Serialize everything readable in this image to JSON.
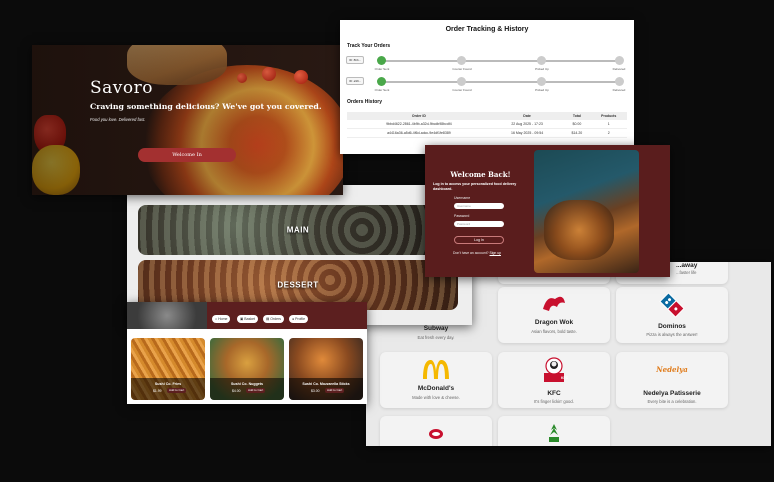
{
  "hero": {
    "brand": "Savoro",
    "tagline": "Craving something delicious? We've got you covered.",
    "subtext": "Food you love. Delivered fast.",
    "cta": "Welcome In"
  },
  "orders": {
    "title": "Order Tracking & History",
    "track_heading": "Track Your Orders",
    "history_heading": "Orders History",
    "trackers": [
      {
        "id": "ID: 8bb...",
        "steps": [
          "Order Sent",
          "Courier Found",
          "Picked Up",
          "Delivered"
        ],
        "active": 1
      },
      {
        "id": "ID: a99...",
        "steps": [
          "Order Sent",
          "Courier Found",
          "Picked Up",
          "Delivered"
        ],
        "active": 1
      }
    ],
    "columns": [
      "Order ID",
      "Date",
      "Total",
      "Products"
    ],
    "rows": [
      {
        "id": "9bbd4622-2861-4b9b-a32d-9bcdb98bcdf4",
        "date": "22 Aug 2025 - 17:23",
        "total": "$0.00",
        "products": "1"
      },
      {
        "id": "a4416a36-a5d6-4f6d-adcc-9e4df1fe8389",
        "date": "16 May 2025 - 09:54",
        "total": "$14.20",
        "products": "2"
      }
    ]
  },
  "login": {
    "title": "Welcome Back!",
    "subtitle": "Log in to access your personalized food delivery dashboard.",
    "username_label": "Username",
    "username_placeholder": "Username",
    "password_label": "Password",
    "password_placeholder": "Password",
    "button": "Log In",
    "signup_prompt": "Don't have an account?",
    "signup_link": "Sign up"
  },
  "categories": {
    "items": [
      "MAIN",
      "DESSERT"
    ]
  },
  "menu": {
    "nav": [
      "Home",
      "Basket",
      "Orders",
      "Profile"
    ],
    "items": [
      {
        "name": "Sushi Co. Fries",
        "price": "$1.99",
        "button": "Add to Cart"
      },
      {
        "name": "Sushi Co. Nuggets",
        "price": "$4.00",
        "button": "Add to Cart"
      },
      {
        "name": "Sushi Co. Mozzarella Sticks",
        "price": "$3.00",
        "button": "Add to Cart"
      }
    ]
  },
  "restaurants": {
    "top_partial": {
      "name": "...away",
      "desc": "...faster life"
    },
    "items": [
      {
        "name": "Subway",
        "desc": "Eat fresh every day.",
        "logo": "subway-logo"
      },
      {
        "name": "Dragon Wok",
        "desc": "Asian flavors, bold taste.",
        "logo": "dragon-wok-logo"
      },
      {
        "name": "Dominos",
        "desc": "Pizza is always the answer!",
        "logo": "dominos-logo"
      },
      {
        "name": "McDonald's",
        "desc": "Made with love & cheese.",
        "logo": "mcdonalds-logo"
      },
      {
        "name": "KFC",
        "desc": "It's finger lickin' good.",
        "logo": "kfc-logo"
      },
      {
        "name": "Nedelya Patisserie",
        "desc": "Every bite is a celebration.",
        "logo": "nedelya-logo"
      }
    ],
    "logo_text": {
      "kfc": "KFC",
      "nedelya": "Nedelya"
    },
    "colors": {
      "mcd": "#f5b800",
      "kfc": "#c8102e",
      "dominos": "#0a6aa1",
      "nedelya": "#e07b1a"
    }
  },
  "colors": {
    "maroon": "#5c1f1f",
    "hero_btn": "#a33030",
    "green": "#4aa84a"
  }
}
